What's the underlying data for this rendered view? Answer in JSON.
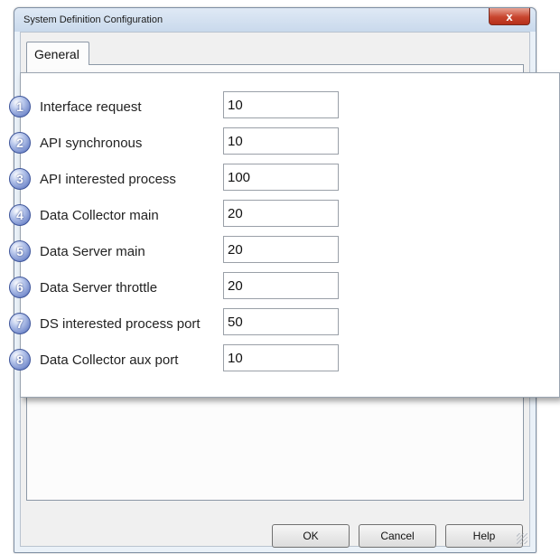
{
  "window": {
    "title": "System Definition Configuration",
    "close_label": "x"
  },
  "tabs": [
    {
      "label": "General"
    }
  ],
  "settings": [
    {
      "num": "1",
      "label": "Interface request",
      "value": "10"
    },
    {
      "num": "2",
      "label": "API synchronous",
      "value": "10"
    },
    {
      "num": "3",
      "label": "API interested process",
      "value": "100"
    },
    {
      "num": "4",
      "label": "Data Collector main",
      "value": "20"
    },
    {
      "num": "5",
      "label": "Data Server main",
      "value": "20"
    },
    {
      "num": "6",
      "label": "Data Server throttle",
      "value": "20"
    },
    {
      "num": "7",
      "label": "DS interested process port",
      "value": "50"
    },
    {
      "num": "8",
      "label": "Data Collector aux port",
      "value": "10"
    }
  ],
  "buttons": {
    "ok": "OK",
    "cancel": "Cancel",
    "help": "Help"
  },
  "colors": {
    "badge": "#4b66b8",
    "close_button": "#c8452e",
    "window_frame": "#eaf1f8"
  }
}
